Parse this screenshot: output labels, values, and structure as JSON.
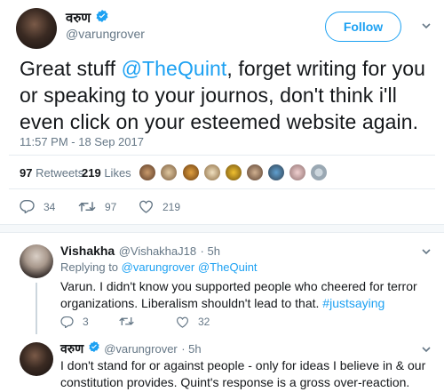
{
  "author": {
    "name": "वरुण",
    "handle": "@varungrover"
  },
  "follow_label": "Follow",
  "tweet": {
    "pre": "Great stuff ",
    "mention": "@TheQuint",
    "post": ", forget writing for you or speaking to your journos, don't think i'll even click on your esteemed website again.",
    "timestamp": "11:57 PM - 18 Sep 2017",
    "retweets_count": "97",
    "retweets_label": "Retweets",
    "likes_count": "219",
    "likes_label": "Likes",
    "actions": {
      "replies": "34",
      "retweets": "97",
      "likes": "219"
    }
  },
  "reply1": {
    "name": "Vishakha",
    "handle": "@VishakhaJ18",
    "time": "· 5h",
    "replying_to_label": "Replying to",
    "replying_to_1": "@varungrover",
    "replying_to_2": "@TheQuint",
    "text": "Varun. I didn't know you supported people who cheered for terror organizations. Liberalism shouldn't lead to that.",
    "hashtag": "#justsaying",
    "actions": {
      "replies": "3",
      "retweets": "",
      "likes": "32"
    }
  },
  "reply2": {
    "name": "वरुण",
    "handle": "@varungrover",
    "time": "· 5h",
    "text": "I don't stand for or against people - only for ideas I believe in & our constitution provides. Quint's response is a gross over-reaction."
  },
  "colors": {
    "accent": "#1da1f2",
    "muted": "#657786",
    "text": "#14171a",
    "divider": "#e6ecf0"
  },
  "icons": [
    "verified-badge-icon",
    "reply-icon",
    "retweet-icon",
    "like-icon"
  ]
}
